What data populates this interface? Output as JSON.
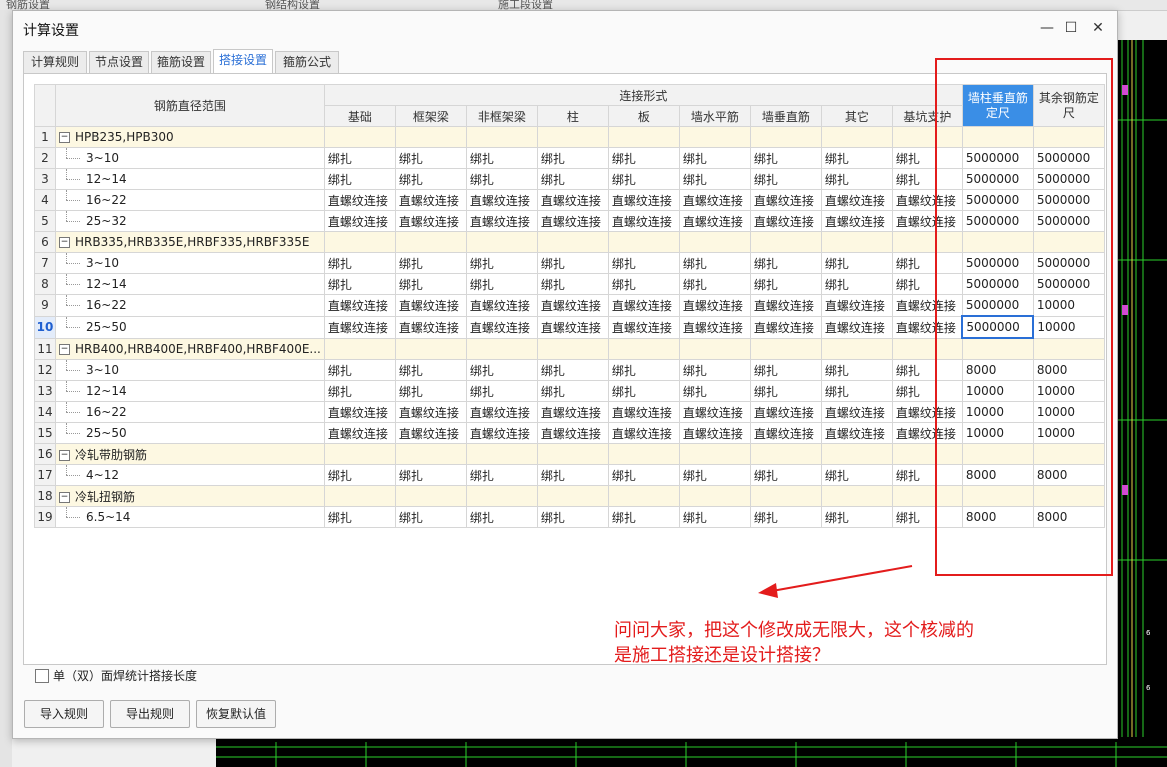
{
  "background": {
    "top_tabs": [
      "钢筋设置",
      "钢结构设置",
      "施工段设置"
    ]
  },
  "dialog": {
    "title": "计算设置",
    "window_controls": {
      "minimize": "—",
      "maximize": "☐",
      "close": "✕"
    },
    "tabs": [
      {
        "label": "计算规则"
      },
      {
        "label": "节点设置"
      },
      {
        "label": "箍筋设置"
      },
      {
        "label": "搭接设置"
      },
      {
        "label": "箍筋公式"
      }
    ],
    "active_tab": "搭接设置"
  },
  "grid": {
    "header": {
      "range_col": "钢筋直径范围",
      "group_label": "连接形式",
      "sub_cols": [
        "基础",
        "框架梁",
        "非框架梁",
        "柱",
        "板",
        "墙水平筋",
        "墙垂直筋",
        "其它",
        "基坑支护"
      ],
      "col_wall_fixed": "墙柱垂直筋定尺",
      "col_other_fixed": "其余钢筋定尺"
    },
    "rows": [
      {
        "no": "1",
        "range": "HPB235,HPB300",
        "group": true,
        "conn": [
          "",
          "",
          "",
          "",
          "",
          "",
          "",
          "",
          ""
        ],
        "wall": "",
        "other": ""
      },
      {
        "no": "2",
        "range": "3~10",
        "group": false,
        "conn": [
          "绑扎",
          "绑扎",
          "绑扎",
          "绑扎",
          "绑扎",
          "绑扎",
          "绑扎",
          "绑扎",
          "绑扎"
        ],
        "wall": "5000000",
        "other": "5000000"
      },
      {
        "no": "3",
        "range": "12~14",
        "group": false,
        "conn": [
          "绑扎",
          "绑扎",
          "绑扎",
          "绑扎",
          "绑扎",
          "绑扎",
          "绑扎",
          "绑扎",
          "绑扎"
        ],
        "wall": "5000000",
        "other": "5000000"
      },
      {
        "no": "4",
        "range": "16~22",
        "group": false,
        "conn": [
          "直螺纹连接",
          "直螺纹连接",
          "直螺纹连接",
          "直螺纹连接",
          "直螺纹连接",
          "直螺纹连接",
          "直螺纹连接",
          "直螺纹连接",
          "直螺纹连接"
        ],
        "wall": "5000000",
        "other": "5000000"
      },
      {
        "no": "5",
        "range": "25~32",
        "group": false,
        "conn": [
          "直螺纹连接",
          "直螺纹连接",
          "直螺纹连接",
          "直螺纹连接",
          "直螺纹连接",
          "直螺纹连接",
          "直螺纹连接",
          "直螺纹连接",
          "直螺纹连接"
        ],
        "wall": "5000000",
        "other": "5000000"
      },
      {
        "no": "6",
        "range": "HRB335,HRB335E,HRBF335,HRBF335E",
        "group": true,
        "conn": [
          "",
          "",
          "",
          "",
          "",
          "",
          "",
          "",
          ""
        ],
        "wall": "",
        "other": ""
      },
      {
        "no": "7",
        "range": "3~10",
        "group": false,
        "conn": [
          "绑扎",
          "绑扎",
          "绑扎",
          "绑扎",
          "绑扎",
          "绑扎",
          "绑扎",
          "绑扎",
          "绑扎"
        ],
        "wall": "5000000",
        "other": "5000000"
      },
      {
        "no": "8",
        "range": "12~14",
        "group": false,
        "conn": [
          "绑扎",
          "绑扎",
          "绑扎",
          "绑扎",
          "绑扎",
          "绑扎",
          "绑扎",
          "绑扎",
          "绑扎"
        ],
        "wall": "5000000",
        "other": "5000000"
      },
      {
        "no": "9",
        "range": "16~22",
        "group": false,
        "conn": [
          "直螺纹连接",
          "直螺纹连接",
          "直螺纹连接",
          "直螺纹连接",
          "直螺纹连接",
          "直螺纹连接",
          "直螺纹连接",
          "直螺纹连接",
          "直螺纹连接"
        ],
        "wall": "5000000",
        "other": "10000"
      },
      {
        "no": "10",
        "range": "25~50",
        "group": false,
        "selected": true,
        "conn": [
          "直螺纹连接",
          "直螺纹连接",
          "直螺纹连接",
          "直螺纹连接",
          "直螺纹连接",
          "直螺纹连接",
          "直螺纹连接",
          "直螺纹连接",
          "直螺纹连接"
        ],
        "wall": "5000000",
        "other": "10000"
      },
      {
        "no": "11",
        "range": "HRB400,HRB400E,HRBF400,HRBF400E...",
        "group": true,
        "conn": [
          "",
          "",
          "",
          "",
          "",
          "",
          "",
          "",
          ""
        ],
        "wall": "",
        "other": ""
      },
      {
        "no": "12",
        "range": "3~10",
        "group": false,
        "conn": [
          "绑扎",
          "绑扎",
          "绑扎",
          "绑扎",
          "绑扎",
          "绑扎",
          "绑扎",
          "绑扎",
          "绑扎"
        ],
        "wall": "8000",
        "other": "8000"
      },
      {
        "no": "13",
        "range": "12~14",
        "group": false,
        "conn": [
          "绑扎",
          "绑扎",
          "绑扎",
          "绑扎",
          "绑扎",
          "绑扎",
          "绑扎",
          "绑扎",
          "绑扎"
        ],
        "wall": "10000",
        "other": "10000"
      },
      {
        "no": "14",
        "range": "16~22",
        "group": false,
        "conn": [
          "直螺纹连接",
          "直螺纹连接",
          "直螺纹连接",
          "直螺纹连接",
          "直螺纹连接",
          "直螺纹连接",
          "直螺纹连接",
          "直螺纹连接",
          "直螺纹连接"
        ],
        "wall": "10000",
        "other": "10000"
      },
      {
        "no": "15",
        "range": "25~50",
        "group": false,
        "conn": [
          "直螺纹连接",
          "直螺纹连接",
          "直螺纹连接",
          "直螺纹连接",
          "直螺纹连接",
          "直螺纹连接",
          "直螺纹连接",
          "直螺纹连接",
          "直螺纹连接"
        ],
        "wall": "10000",
        "other": "10000"
      },
      {
        "no": "16",
        "range": "冷轧带肋钢筋",
        "group": true,
        "conn": [
          "",
          "",
          "",
          "",
          "",
          "",
          "",
          "",
          ""
        ],
        "wall": "",
        "other": ""
      },
      {
        "no": "17",
        "range": "4~12",
        "group": false,
        "conn": [
          "绑扎",
          "绑扎",
          "绑扎",
          "绑扎",
          "绑扎",
          "绑扎",
          "绑扎",
          "绑扎",
          "绑扎"
        ],
        "wall": "8000",
        "other": "8000"
      },
      {
        "no": "18",
        "range": "冷轧扭钢筋",
        "group": true,
        "conn": [
          "",
          "",
          "",
          "",
          "",
          "",
          "",
          "",
          ""
        ],
        "wall": "",
        "other": ""
      },
      {
        "no": "19",
        "range": "6.5~14",
        "group": false,
        "conn": [
          "绑扎",
          "绑扎",
          "绑扎",
          "绑扎",
          "绑扎",
          "绑扎",
          "绑扎",
          "绑扎",
          "绑扎"
        ],
        "wall": "8000",
        "other": "8000"
      }
    ]
  },
  "footer": {
    "checkbox_label": "单（双）面焊统计搭接长度",
    "buttons": [
      "导入规则",
      "导出规则",
      "恢复默认值"
    ]
  },
  "annotation": {
    "line1": "问问大家，把这个修改成无限大，这个核减的",
    "line2": "是施工搭接还是设计搭接？",
    "color": "#e31c1c"
  }
}
